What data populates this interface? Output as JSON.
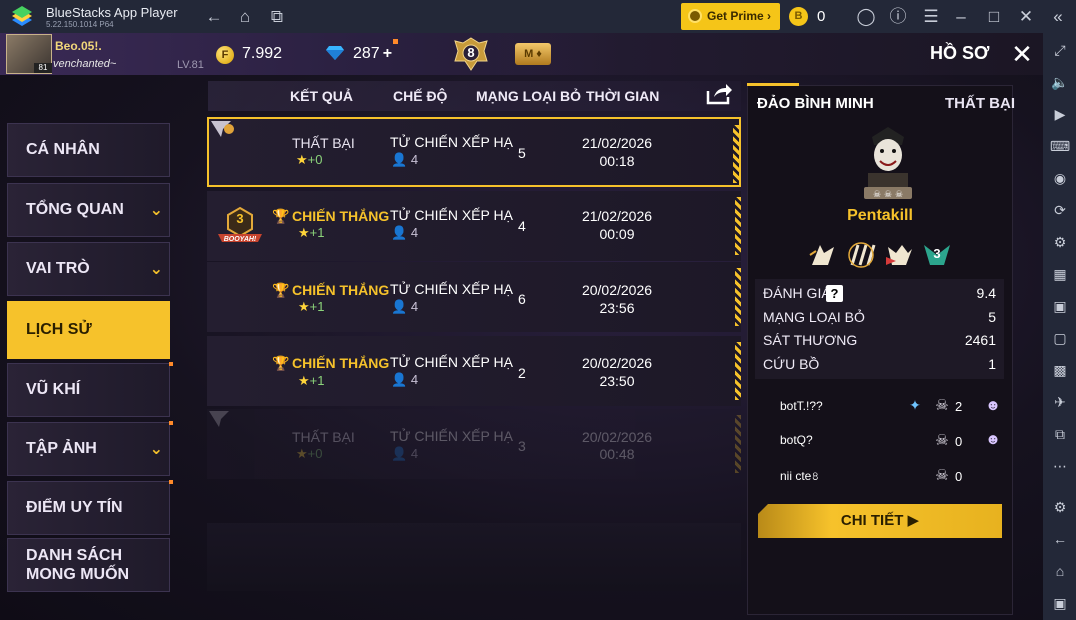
{
  "emulator": {
    "app_title": "BlueStacks App Player",
    "version": "5.22.150.1014  P64",
    "get_prime_label": "Get Prime",
    "coin_count": "0",
    "icons": [
      "back-icon",
      "home-icon",
      "recent-apps-icon",
      "account-icon",
      "help-icon",
      "menu-icon",
      "minimize-icon",
      "maximize-icon",
      "close-icon",
      "expand-icon"
    ],
    "sidebar_icons": [
      "fullscreen-icon",
      "volume-icon",
      "media-icon",
      "keyboard-icon",
      "record-icon",
      "sync-icon",
      "macro-icon",
      "apk-icon",
      "screenshot-icon",
      "resize-icon",
      "gallery-icon",
      "airplane-icon",
      "multi-instance-icon",
      "more-icon",
      "settings-icon",
      "back-icon",
      "home-icon",
      "recents-icon"
    ]
  },
  "topbar": {
    "player_name": "Beo.05!.",
    "player_signature": "venchanted~",
    "avatar_level": "81",
    "level": "LV.81",
    "gold": "7.992",
    "diamonds": "287",
    "diamond_plus": "+",
    "rank_number": "8",
    "membership_letter": "M",
    "screen_title": "HỒ SƠ"
  },
  "nav": {
    "items": [
      {
        "label": "CÁ NHÂN",
        "has_chevron": false
      },
      {
        "label": "TỔNG QUAN",
        "has_chevron": true
      },
      {
        "label": "VAI TRÒ",
        "has_chevron": true
      },
      {
        "label": "LỊCH SỬ",
        "active": true
      },
      {
        "label": "VŨ KHÍ"
      },
      {
        "label": "TẬP ẢNH",
        "has_chevron": true
      },
      {
        "label": "ĐIỂM UY TÍN"
      },
      {
        "label_line1": "DANH SÁCH",
        "label_line2": "MONG MUỐN"
      }
    ]
  },
  "history": {
    "columns": [
      "KẾT QUẢ",
      "CHẾ ĐỘ",
      "MẠNG LOẠI BỎ",
      "THỜI GIAN"
    ],
    "rows": [
      {
        "result": "THẤT BẠI",
        "win": false,
        "points": "+0",
        "mode": "TỬ CHIẾN XẾP HẠ",
        "players": "4",
        "kills": "5",
        "date": "21/02/2026",
        "time": "00:18"
      },
      {
        "result": "CHIẾN THẮNG",
        "win": true,
        "points": "+1",
        "mode": "TỬ CHIẾN XẾP HẠ",
        "players": "4",
        "kills": "4",
        "date": "21/02/2026",
        "time": "00:09",
        "booyah_rank": "3",
        "booyah_text": "BOOYAH!"
      },
      {
        "result": "CHIẾN THẮNG",
        "win": true,
        "points": "+1",
        "mode": "TỬ CHIẾN XẾP HẠ",
        "players": "4",
        "kills": "6",
        "date": "20/02/2026",
        "time": "23:56"
      },
      {
        "result": "CHIẾN THẮNG",
        "win": true,
        "points": "+1",
        "mode": "TỬ CHIẾN XẾP HẠ",
        "players": "4",
        "kills": "2",
        "date": "20/02/2026",
        "time": "23:50"
      },
      {
        "result": "THẤT BẠI",
        "win": false,
        "points": "+0",
        "mode": "TỬ CHIẾN XẾP HẠ",
        "players": "4",
        "kills": "3",
        "date": "20/02/2026",
        "time": "00:48"
      }
    ]
  },
  "detail": {
    "map": "ĐẢO BÌNH MINH",
    "result": "THẤT BẠI",
    "title": "Pentakill",
    "medal_badge": "3",
    "stats": [
      {
        "label": "ĐÁNH GIÁ",
        "value": "9.4"
      },
      {
        "label": "MẠNG LOẠI BỎ",
        "value": "5"
      },
      {
        "label": "SÁT THƯƠNG",
        "value": "2461"
      },
      {
        "label": "CỨU BỒ",
        "value": "1"
      }
    ],
    "team": [
      {
        "name": "botT.!??",
        "kills": "2"
      },
      {
        "name": "botQ?",
        "kills": "0"
      },
      {
        "name": "nii cte৪",
        "kills": "0"
      }
    ],
    "detail_button": "CHI TIẾT"
  }
}
